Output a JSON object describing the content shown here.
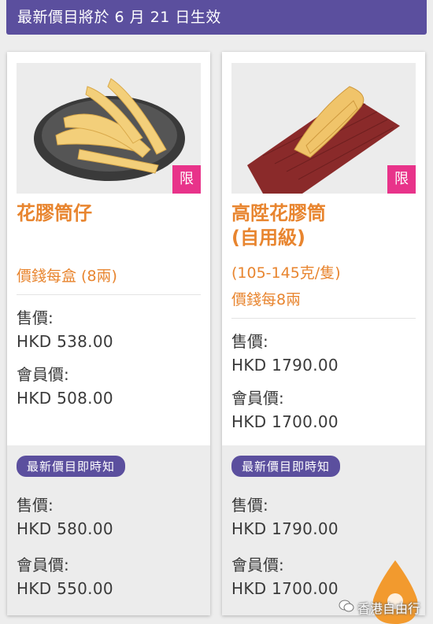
{
  "banner": {
    "text": "最新價目將於 6 月 21 日生效"
  },
  "products": [
    {
      "name_lines": [
        "花膠筒仔"
      ],
      "info_lines": [
        "價錢每盒 (8兩)"
      ],
      "badge": "限",
      "current": {
        "sale_label": "售價:",
        "sale_price": "HKD 538.00",
        "member_label": "會員價:",
        "member_price": "HKD 508.00"
      },
      "notice": "最新價目即時知",
      "upcoming": {
        "sale_label": "售價:",
        "sale_price": "HKD 580.00",
        "member_label": "會員價:",
        "member_price": "HKD 550.00"
      }
    },
    {
      "name_lines": [
        "高陞花膠筒",
        "(自用級)"
      ],
      "info_lines": [
        "(105-145克/隻)",
        "價錢每8兩"
      ],
      "badge": "限",
      "current": {
        "sale_label": "售價:",
        "sale_price": "HKD 1790.00",
        "member_label": "會員價:",
        "member_price": "HKD 1700.00"
      },
      "notice": "最新價目即時知",
      "upcoming": {
        "sale_label": "售價:",
        "sale_price": "HKD 1790.00",
        "member_label": "會員價:",
        "member_price": "HKD 1700.00"
      }
    }
  ],
  "watermark": {
    "text": "香港自由行"
  },
  "colors": {
    "brand_purple": "#5b4f9e",
    "accent_orange": "#e8852f",
    "badge_pink": "#e8338a"
  }
}
